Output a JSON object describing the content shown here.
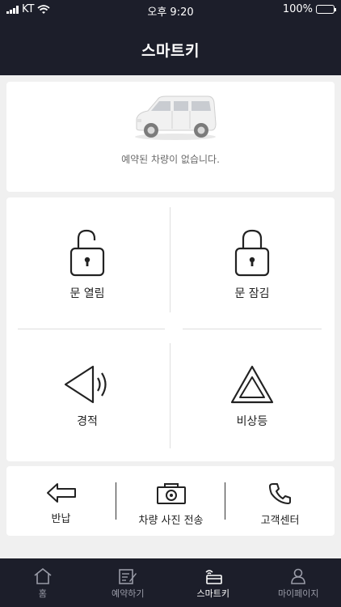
{
  "status_bar": {
    "carrier": "KT",
    "time": "오후 9:20",
    "battery": "100%"
  },
  "header": {
    "title": "스마트키"
  },
  "vehicle": {
    "icon": "car-icon",
    "message": "예약된 차량이 없습니다."
  },
  "controls": [
    {
      "label": "문 열림",
      "icon": "unlock-icon"
    },
    {
      "label": "문 잠김",
      "icon": "lock-icon"
    },
    {
      "label": "경적",
      "icon": "horn-icon"
    },
    {
      "label": "비상등",
      "icon": "hazard-icon"
    }
  ],
  "actions": [
    {
      "label": "반납",
      "icon": "return-arrow-icon"
    },
    {
      "label": "차량 사진 전송",
      "icon": "camera-icon"
    },
    {
      "label": "고객센터",
      "icon": "phone-icon"
    }
  ],
  "tabs": [
    {
      "label": "홈",
      "icon": "home-icon",
      "active": false
    },
    {
      "label": "예약하기",
      "icon": "reserve-icon",
      "active": false
    },
    {
      "label": "스마트키",
      "icon": "smartkey-icon",
      "active": true
    },
    {
      "label": "마이페이지",
      "icon": "profile-icon",
      "active": false
    }
  ],
  "colors": {
    "header_bg": "#1c1e2a",
    "page_bg": "#f0f0f0",
    "card_bg": "#ffffff",
    "tab_inactive": "#9a9ca8",
    "tab_active": "#ffffff"
  }
}
